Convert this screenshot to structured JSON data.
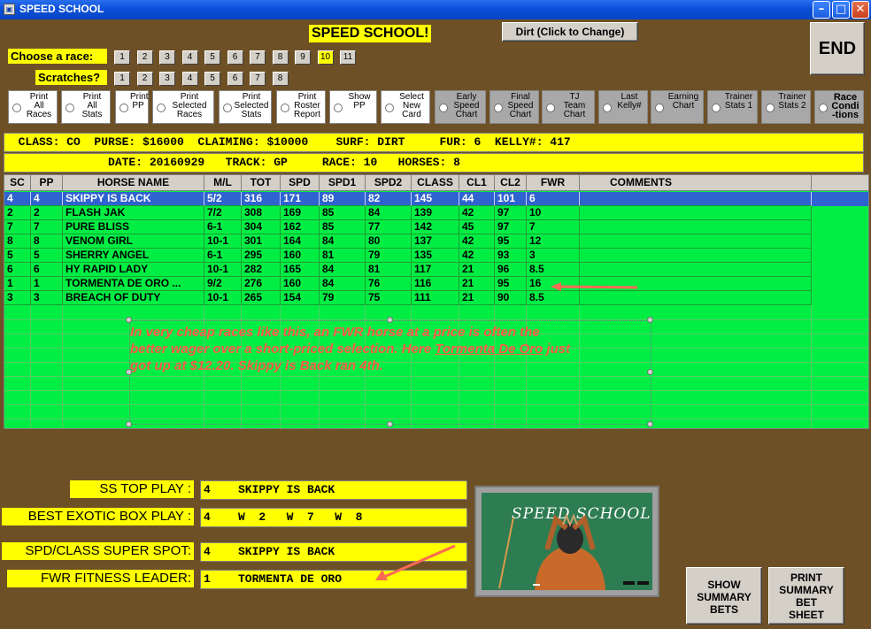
{
  "window": {
    "title": "SPEED SCHOOL",
    "icon": "app-window-icon"
  },
  "header": {
    "banner": "SPEED SCHOOL!",
    "surface_button": "Dirt (Click to Change)",
    "end_button": "END",
    "choose_label": "Choose  a race:",
    "scratches_label": "Scratches?",
    "race_numbers": [
      "1",
      "2",
      "3",
      "4",
      "5",
      "6",
      "7",
      "8",
      "9",
      "10",
      "11"
    ],
    "selected_race": "10",
    "scratch_numbers": [
      "1",
      "2",
      "3",
      "4",
      "5",
      "6",
      "7",
      "8"
    ]
  },
  "options": [
    "Print\nAll\nRaces",
    "Print\nAll\nStats",
    "Print\nPP",
    "Print\nSelected\nRaces",
    "Print\nSelected\nStats",
    "Print\nRoster\nReport",
    "Show\nPP",
    "Select\nNew\nCard",
    "Early\nSpeed\nChart",
    "Final\nSpeed\nChart",
    "TJ\nTeam\nChart",
    "Last\nKelly#",
    "Earning\nChart",
    "Trainer\nStats 1",
    "Trainer\nStats 2",
    "Race\nCondi\n-tions"
  ],
  "info": {
    "line1": "  CLASS: CO  PURSE: $16000  CLAIMING: $10000    SURF: DIRT     FUR: 6  KELLY#: 417",
    "line2": "               DATE: 20160929   TRACK: GP     RACE: 10   HORSES: 8"
  },
  "table": {
    "columns": [
      "SC",
      "PP",
      "HORSE NAME",
      "M/L",
      "TOT",
      "SPD",
      "SPD1",
      "SPD2",
      "CLASS",
      "CL1",
      "CL2",
      "FWR",
      "COMMENTS"
    ],
    "rows": [
      [
        "4",
        "4",
        "SKIPPY IS BACK",
        "5/2",
        "316",
        "171",
        "89",
        "82",
        "145",
        "44",
        "101",
        "6",
        ""
      ],
      [
        "2",
        "2",
        "FLASH JAK",
        "7/2",
        "308",
        "169",
        "85",
        "84",
        "139",
        "42",
        "97",
        "10",
        ""
      ],
      [
        "7",
        "7",
        "PURE BLISS",
        "6-1",
        "304",
        "162",
        "85",
        "77",
        "142",
        "45",
        "97",
        "7",
        ""
      ],
      [
        "8",
        "8",
        "VENOM GIRL",
        "10-1",
        "301",
        "164",
        "84",
        "80",
        "137",
        "42",
        "95",
        "12",
        ""
      ],
      [
        "5",
        "5",
        "SHERRY ANGEL",
        "6-1",
        "295",
        "160",
        "81",
        "79",
        "135",
        "42",
        "93",
        "3",
        ""
      ],
      [
        "6",
        "6",
        "HY RAPID LADY",
        "10-1",
        "282",
        "165",
        "84",
        "81",
        "117",
        "21",
        "96",
        "8.5",
        ""
      ],
      [
        "1",
        "1",
        "TORMENTA DE ORO ...",
        "9/2",
        "276",
        "160",
        "84",
        "76",
        "116",
        "21",
        "95",
        "16",
        ""
      ],
      [
        "3",
        "3",
        "BREACH OF DUTY",
        "10-1",
        "265",
        "154",
        "79",
        "75",
        "111",
        "21",
        "90",
        "8.5",
        ""
      ]
    ],
    "selected_row": 0
  },
  "annotation": {
    "line1": "In very cheap races like this, an FWR horse at a price is often the",
    "line2a": "better wager over a short-priced selection.  Here ",
    "line2u": "Tormenta De Oro",
    "line2b": "  just",
    "line3": "got up at $12.20.  Skippy is Back ran 4th."
  },
  "summary": {
    "top_play_label": "SS TOP PLAY :",
    "top_play_value": "4    SKIPPY IS BACK",
    "exotic_label": "BEST EXOTIC BOX PLAY :",
    "exotic_value": "4    W  2   W  7   W  8",
    "super_spot_label": "SPD/CLASS SUPER SPOT:",
    "super_spot_value": "4    SKIPPY IS BACK",
    "fitness_label": "FWR FITNESS LEADER:",
    "fitness_value": "1    TORMENTA DE ORO"
  },
  "board": {
    "text": "SPEED SCHOOL"
  },
  "buttons": {
    "show_summary": "SHOW\nSUMMARY\nBETS",
    "print_summary": "PRINT\nSUMMARY\nBET\nSHEET"
  },
  "colors": {
    "highlight": "#ffff00",
    "grid": "#00ee44",
    "arrow": "#ff6a55",
    "selected_row": "#2f63cf"
  }
}
